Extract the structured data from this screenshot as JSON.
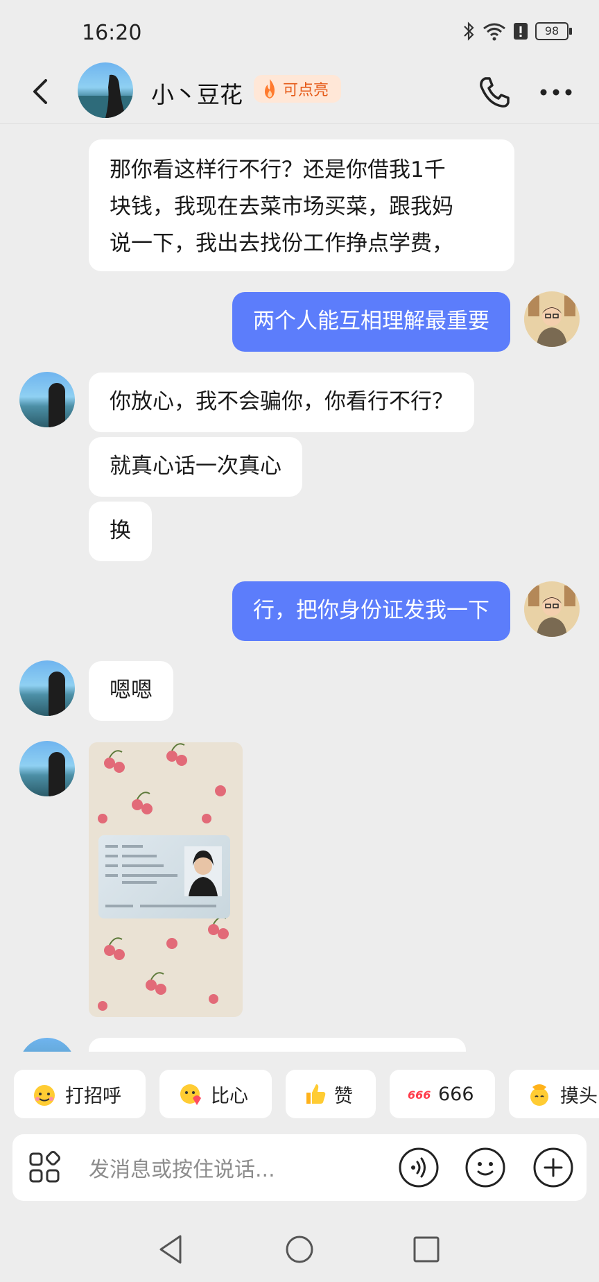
{
  "status": {
    "time": "16:20",
    "battery": "98"
  },
  "header": {
    "name": "小丶豆花",
    "badge": "可点亮",
    "icons": [
      "back-icon",
      "phone-icon",
      "more-icon"
    ]
  },
  "messages": [
    {
      "side": "left",
      "text_lines": [
        "那你看这样行不行？还是你借我1千",
        "块钱，我现在去菜市场买菜，跟我妈",
        "说一下，我出去找份工作挣点学费，"
      ]
    },
    {
      "side": "right",
      "text": "两个人能互相理解最重要"
    },
    {
      "side": "left",
      "text": "你放心，我不会骗你，你看行不行？"
    },
    {
      "side": "left",
      "text": "就真心话一次真心"
    },
    {
      "side": "left",
      "text": "换"
    },
    {
      "side": "right",
      "text": "行，把你身份证发我一下"
    },
    {
      "side": "left",
      "text": "嗯嗯"
    },
    {
      "side": "left",
      "type": "image",
      "description_icon": "id-card-photo"
    }
  ],
  "quick_replies": [
    {
      "label": "打招呼",
      "icon": "emoji-wave-icon"
    },
    {
      "label": "比心",
      "icon": "emoji-heart-icon"
    },
    {
      "label": "赞",
      "icon": "thumbs-up-icon"
    },
    {
      "label": "666",
      "icon": "six-icon"
    },
    {
      "label": "摸头",
      "icon": "pat-head-icon"
    }
  ],
  "input": {
    "placeholder": "发消息或按住说话..."
  },
  "colors": {
    "bg": "#ededed",
    "right_bubble": "#5c7dfb",
    "left_bubble": "#ffffff",
    "badge_bg": "#ffe7d7",
    "badge_text": "#e55a18"
  }
}
